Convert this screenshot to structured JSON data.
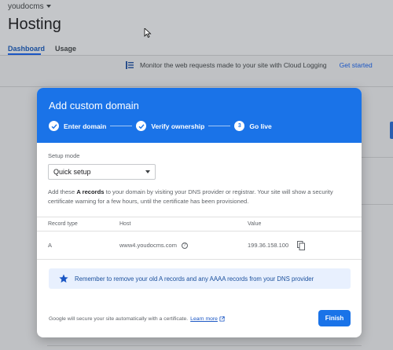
{
  "background": {
    "project_name": "youdocms",
    "page_title": "Hosting",
    "tabs": [
      {
        "label": "Dashboard"
      },
      {
        "label": "Usage"
      }
    ],
    "banner": {
      "text": "Monitor the web requests made to your site with Cloud Logging",
      "link": "Get started"
    }
  },
  "dialog": {
    "title": "Add custom domain",
    "steps": [
      {
        "label": "Enter domain",
        "state": "done"
      },
      {
        "label": "Verify ownership",
        "state": "done"
      },
      {
        "number": "3",
        "label": "Go live",
        "state": "current"
      }
    ],
    "setup_mode": {
      "label": "Setup mode",
      "value": "Quick setup"
    },
    "description": {
      "prefix": "Add these ",
      "bold": "A records",
      "suffix": " to your domain by visiting your DNS provider or registrar. Your site will show a security certificate warning for a few hours, until the certificate has been provisioned."
    },
    "records_table": {
      "columns": [
        "Record type",
        "Host",
        "Value"
      ],
      "rows": [
        {
          "type": "A",
          "host": "www4.youdocms.com",
          "value": "199.36.158.100"
        }
      ]
    },
    "notice": "Remember to remove your old A records and any AAAA records from your DNS provider",
    "footer": {
      "text": "Google will secure your site automatically with a certificate.",
      "link": "Learn more"
    },
    "finish_label": "Finish"
  },
  "colors": {
    "primary": "#1a73e8",
    "notice_bg": "#e8f0fe"
  }
}
